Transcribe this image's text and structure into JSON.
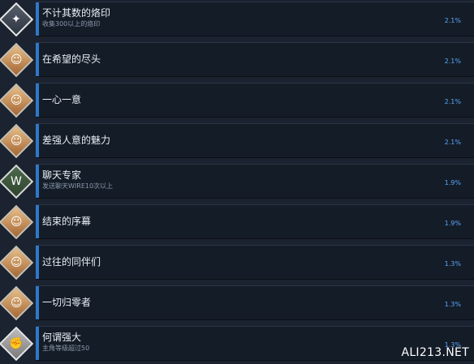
{
  "achievements": [
    {
      "title": "不计其数的烙印",
      "description": "收集300以上的烙印",
      "percent": "2.1%",
      "icon": "compass-star-icon"
    },
    {
      "title": "在希望的尽头",
      "description": "",
      "percent": "2.1%",
      "icon": "character-icon"
    },
    {
      "title": "一心一意",
      "description": "",
      "percent": "2.1%",
      "icon": "character-icon"
    },
    {
      "title": "差强人意的魅力",
      "description": "",
      "percent": "2.1%",
      "icon": "character-icon"
    },
    {
      "title": "聊天专家",
      "description": "发送聊天WIRE10次以上",
      "percent": "1.9%",
      "icon": "wire-logo-icon"
    },
    {
      "title": "结束的序幕",
      "description": "",
      "percent": "1.9%",
      "icon": "character-icon"
    },
    {
      "title": "过往的同伴们",
      "description": "",
      "percent": "1.3%",
      "icon": "character-icon"
    },
    {
      "title": "一切归零者",
      "description": "",
      "percent": "1.3%",
      "icon": "character-icon"
    },
    {
      "title": "何谓强大",
      "description": "主角等级超过50",
      "percent": "1.3%",
      "icon": "muscle-arm-icon"
    }
  ],
  "watermark": "ALI213.NET",
  "colors": {
    "background": "#1b2330",
    "panel": "#141c27",
    "accent_bar": "#2f78c9",
    "percent_text": "#5aa7ff"
  }
}
